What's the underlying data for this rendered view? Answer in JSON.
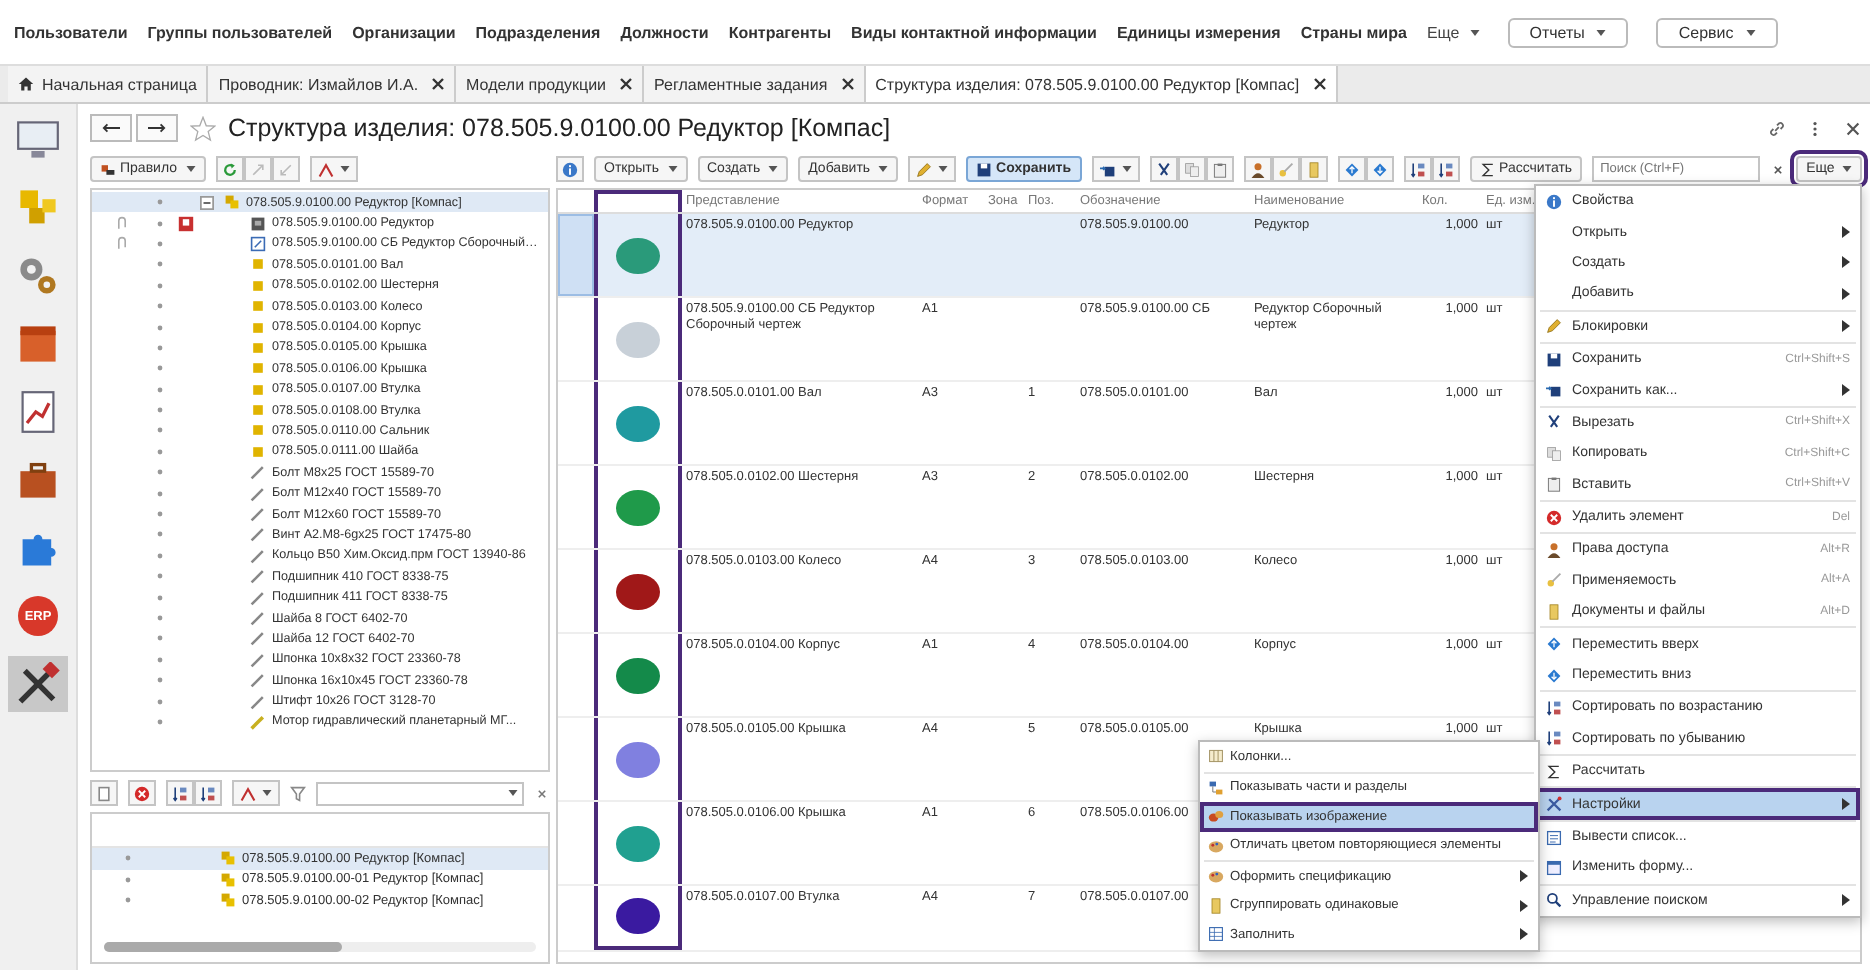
{
  "top_menu": {
    "items": [
      "Пользователи",
      "Группы пользователей",
      "Организации",
      "Подразделения",
      "Должности",
      "Контрагенты",
      "Виды контактной информации",
      "Единицы измерения",
      "Страны мира"
    ],
    "more": "Еще",
    "buttons": [
      "Отчеты",
      "Сервис"
    ]
  },
  "tabs": [
    {
      "label": "Начальная страница",
      "selected": false,
      "kind": "home"
    },
    {
      "label": "Проводник: Измайлов И.А.",
      "selected": false,
      "kind": "document"
    },
    {
      "label": "Модели продукции",
      "selected": false,
      "kind": "document"
    },
    {
      "label": "Регламентные задания",
      "selected": false,
      "kind": "document"
    },
    {
      "label": "Структура изделия: 078.505.9.0100.00 Редуктор [Компас]",
      "selected": true,
      "kind": "document"
    }
  ],
  "sidebar": {
    "items": [
      {
        "selected": false
      },
      {
        "selected": false
      },
      {
        "selected": false
      },
      {
        "selected": false
      },
      {
        "selected": false
      },
      {
        "selected": false
      },
      {
        "selected": false
      },
      {
        "label": "ERP",
        "selected": false
      },
      {
        "selected": true
      }
    ]
  },
  "form": {
    "title": "Структура изделия: 078.505.9.0100.00 Редуктор [Компас]",
    "favorite": false
  },
  "tree_toolbar": {
    "rule_button": "Правило"
  },
  "tree": [
    {
      "label": "078.505.9.0100.00 Редуктор [Компас]",
      "kind": "assembly",
      "expanded": true,
      "selected": true,
      "children": [
        {
          "label": "078.505.9.0100.00 Редуктор",
          "kind": "model"
        },
        {
          "label": "078.505.9.0100.00 СБ Редуктор Сборочный…",
          "kind": "drawing"
        },
        {
          "label": "078.505.0.0101.00 Вал",
          "kind": "part"
        },
        {
          "label": "078.505.0.0102.00 Шестерня",
          "kind": "part"
        },
        {
          "label": "078.505.0.0103.00 Колесо",
          "kind": "part"
        },
        {
          "label": "078.505.0.0104.00 Корпус",
          "kind": "part"
        },
        {
          "label": "078.505.0.0105.00 Крышка",
          "kind": "part"
        },
        {
          "label": "078.505.0.0106.00 Крышка",
          "kind": "part"
        },
        {
          "label": "078.505.0.0107.00 Втулка",
          "kind": "part"
        },
        {
          "label": "078.505.0.0108.00 Втулка",
          "kind": "part"
        },
        {
          "label": "078.505.0.0110.00 Сальник",
          "kind": "part"
        },
        {
          "label": "078.505.0.0111.00 Шайба",
          "kind": "part"
        },
        {
          "label": "Болт М8х25 ГОСТ 15589-70",
          "kind": "standard"
        },
        {
          "label": "Болт М12х40 ГОСТ 15589-70",
          "kind": "standard"
        },
        {
          "label": "Болт М12х60 ГОСТ 15589-70",
          "kind": "standard"
        },
        {
          "label": "Винт А2.М8-6gх25 ГОСТ 17475-80",
          "kind": "standard"
        },
        {
          "label": "Кольцо В50 Хим.Оксид.прм ГОСТ 13940-86",
          "kind": "standard"
        },
        {
          "label": "Подшипник 410 ГОСТ 8338-75",
          "kind": "standard"
        },
        {
          "label": "Подшипник 411 ГОСТ 8338-75",
          "kind": "standard"
        },
        {
          "label": "Шайба 8 ГОСТ 6402-70",
          "kind": "standard"
        },
        {
          "label": "Шайба 12 ГОСТ 6402-70",
          "kind": "standard"
        },
        {
          "label": "Шпонка 10х8х32 ГОСТ 23360-78",
          "kind": "standard"
        },
        {
          "label": "Шпонка 16х10х45 ГОСТ 23360-78",
          "kind": "standard"
        },
        {
          "label": "Штифт 10х26 ГОСТ 3128-70",
          "kind": "standard"
        },
        {
          "label": "Мотор гидравлический планетарный МГ...",
          "kind": "purchased"
        }
      ]
    }
  ],
  "table_toolbar": {
    "buttons": [
      "Открыть",
      "Создать",
      "Добавить"
    ],
    "save": "Сохранить",
    "calculate": "Рассчитать",
    "search": {
      "placeholder": "Поиск (Ctrl+F)"
    },
    "more": {
      "label": "Еще",
      "highlighted": true
    }
  },
  "table": {
    "picture_column": {
      "highlighted": true
    },
    "columns": [
      "Представление",
      "Формат",
      "Зона",
      "Поз.",
      "Обозначение",
      "Наименование",
      "Кол.",
      "Ед. изм."
    ],
    "rows": [
      {
        "selected": true,
        "color": "#2a9a7a",
        "cells": [
          "078.505.9.0100.00 Редуктор",
          "",
          "",
          "",
          "078.505.9.0100.00",
          "Редуктор",
          "1,000",
          "шт"
        ]
      },
      {
        "selected": false,
        "color": "#c8d0d8",
        "cells": [
          "078.505.9.0100.00 СБ Редуктор Сборочный чертеж",
          "А1",
          "",
          "",
          "078.505.9.0100.00 СБ",
          "Редуктор Сборочный чертеж",
          "1,000",
          "шт"
        ]
      },
      {
        "selected": false,
        "color": "#1f9aa0",
        "cells": [
          "078.505.0.0101.00 Вал",
          "А3",
          "",
          "1",
          "078.505.0.0101.00",
          "Вал",
          "1,000",
          "шт"
        ]
      },
      {
        "selected": false,
        "color": "#1f9a4a",
        "cells": [
          "078.505.0.0102.00 Шестерня",
          "А3",
          "",
          "2",
          "078.505.0.0102.00",
          "Шестерня",
          "1,000",
          "шт"
        ]
      },
      {
        "selected": false,
        "color": "#a01818",
        "cells": [
          "078.505.0.0103.00 Колесо",
          "А4",
          "",
          "3",
          "078.505.0.0103.00",
          "Колесо",
          "1,000",
          "шт"
        ]
      },
      {
        "selected": false,
        "color": "#148a4a",
        "cells": [
          "078.505.0.0104.00 Корпус",
          "А1",
          "",
          "4",
          "078.505.0.0104.00",
          "Корпус",
          "1,000",
          "шт"
        ]
      },
      {
        "selected": false,
        "color": "#8080e0",
        "cells": [
          "078.505.0.0105.00 Крышка",
          "А4",
          "",
          "5",
          "078.505.0.0105.00",
          "Крышка",
          "1,000",
          "шт"
        ]
      },
      {
        "selected": false,
        "color": "#20a090",
        "cells": [
          "078.505.0.0106.00 Крышка",
          "А1",
          "",
          "6",
          "078.505.0.0106.00"
        ]
      },
      {
        "selected": false,
        "color": "#3a1aa0",
        "cells": [
          "078.505.0.0107.00 Втулка",
          "А4",
          "",
          "7",
          "078.505.0.0107.00"
        ]
      }
    ]
  },
  "more_menu": {
    "groups": [
      [
        {
          "label": "Свойства",
          "submenu": false,
          "selected": false
        },
        {
          "label": "Открыть",
          "submenu": true,
          "selected": false
        },
        {
          "label": "Создать",
          "submenu": true,
          "selected": false
        },
        {
          "label": "Добавить",
          "submenu": true,
          "selected": false
        }
      ],
      [
        {
          "label": "Блокировки",
          "submenu": true,
          "selected": false
        }
      ],
      [
        {
          "label": "Сохранить",
          "shortcut": "Ctrl+Shift+S",
          "submenu": false,
          "selected": false
        },
        {
          "label": "Сохранить как...",
          "submenu": true,
          "selected": false
        }
      ],
      [
        {
          "label": "Вырезать",
          "shortcut": "Ctrl+Shift+X",
          "submenu": false,
          "selected": false
        },
        {
          "label": "Копировать",
          "shortcut": "Ctrl+Shift+C",
          "submenu": false,
          "selected": false
        },
        {
          "label": "Вставить",
          "shortcut": "Ctrl+Shift+V",
          "submenu": false,
          "selected": false
        }
      ],
      [
        {
          "label": "Удалить элемент",
          "shortcut": "Del",
          "submenu": false,
          "selected": false
        }
      ],
      [
        {
          "label": "Права доступа",
          "shortcut": "Alt+R",
          "submenu": false,
          "selected": false
        },
        {
          "label": "Применяемость",
          "shortcut": "Alt+A",
          "submenu": false,
          "selected": false
        },
        {
          "label": "Документы и файлы",
          "shortcut": "Alt+D",
          "submenu": false,
          "selected": false
        }
      ],
      [
        {
          "label": "Переместить вверх",
          "submenu": false,
          "selected": false
        },
        {
          "label": "Переместить вниз",
          "submenu": false,
          "selected": false
        }
      ],
      [
        {
          "label": "Сортировать по возрастанию",
          "submenu": false,
          "selected": false
        },
        {
          "label": "Сортировать по убыванию",
          "submenu": false,
          "selected": false
        }
      ],
      [
        {
          "label": "Рассчитать",
          "submenu": false,
          "selected": false
        }
      ],
      [
        {
          "label": "Настройки",
          "submenu": true,
          "selected": true,
          "highlighted": true
        }
      ],
      [
        {
          "label": "Вывести список...",
          "submenu": false,
          "selected": false
        },
        {
          "label": "Изменить форму...",
          "submenu": false,
          "selected": false
        }
      ],
      [
        {
          "label": "Управление поиском",
          "submenu": true,
          "selected": false
        }
      ]
    ]
  },
  "settings_submenu": {
    "groups": [
      [
        {
          "label": "Колонки...",
          "submenu": false,
          "selected": false
        }
      ],
      [
        {
          "label": "Показывать части и разделы",
          "submenu": false,
          "selected": false
        },
        {
          "label": "Показывать изображение",
          "submenu": false,
          "selected": true,
          "highlighted": true
        },
        {
          "label": "Отличать цветом повторяющиеся элементы",
          "submenu": false,
          "selected": false
        }
      ],
      [
        {
          "label": "Оформить спецификацию",
          "submenu": true,
          "selected": false
        },
        {
          "label": "Сгруппировать одинаковые",
          "submenu": true,
          "selected": false
        },
        {
          "label": "Заполнить",
          "submenu": true,
          "selected": false
        }
      ]
    ]
  },
  "variants": {
    "rows": [
      {
        "label": "078.505.9.0100.00 Редуктор [Компас]",
        "selected": true
      },
      {
        "label": "078.505.9.0100.00-01 Редуктор [Компас]",
        "selected": false
      },
      {
        "label": "078.505.9.0100.00-02 Редуктор [Компас]",
        "selected": false
      }
    ]
  }
}
